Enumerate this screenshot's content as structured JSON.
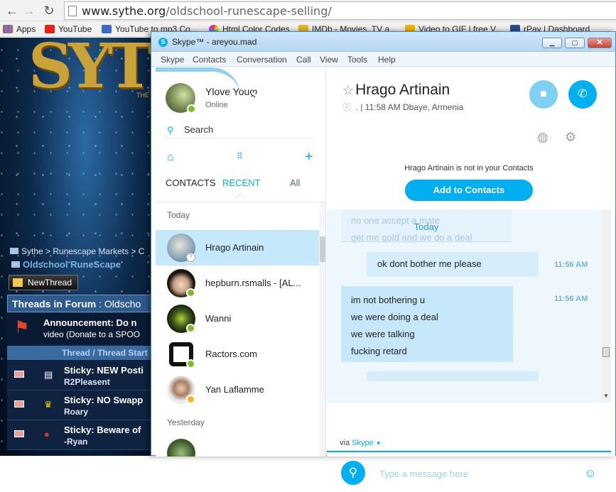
{
  "browser": {
    "url_host": "www.sythe.org",
    "url_path": "/oldschool-runescape-selling/",
    "bookmarks": [
      {
        "label": "Apps",
        "color": "#e0453a"
      },
      {
        "label": "YouTube",
        "color": "#e62117"
      },
      {
        "label": "YouTube to mp3 Co...",
        "color": "#3b6bc4"
      },
      {
        "label": "Html Color Codes",
        "color": "#d54cb8"
      },
      {
        "label": "IMDb - Movies, TV a...",
        "color": "#e3b82a"
      },
      {
        "label": "Video to GIF | free V...",
        "color": "#f5b700"
      },
      {
        "label": "rPay | Dashboard",
        "color": "#2a4b8d"
      }
    ]
  },
  "website": {
    "logo": "SYT",
    "logo_sub": "THE",
    "breadcrumb": "Sythe > Runescape Markets > C",
    "forum": "Oldschool RuneScape",
    "new_thread": "NewThread",
    "threads_header": "Threads in Forum",
    "threads_header_sub": ": Oldscho",
    "announcement_title": "Announcement: Do n",
    "announcement_sub": "video (Donate to a SPOO",
    "col_thread": "Thread",
    "col_starter": "Thread Start",
    "threads": [
      {
        "title": "Sticky: NEW Posti",
        "starter": "R2Pleasent",
        "icon": "doc-icon"
      },
      {
        "title": "Sticky: NO Swapp",
        "starter": "Roary",
        "icon": "crown-icon"
      },
      {
        "title": "Sticky: Beware of",
        "starter": "-Ryan",
        "icon": "warning-icon"
      }
    ]
  },
  "skype": {
    "title": "Skype™ - areyou.mad",
    "menu": [
      "Skype",
      "Contacts",
      "Conversation",
      "Call",
      "View",
      "Tools",
      "Help"
    ],
    "me": {
      "name": "Ylove Youღ",
      "status": "Online"
    },
    "search_label": "Search",
    "tabs": {
      "contacts": "CONTACTS",
      "recent": "RECENT",
      "all": "All"
    },
    "groups": {
      "today": "Today",
      "yesterday": "Yesterday"
    },
    "contacts": [
      {
        "name": "Hrago  Artinain",
        "status": "unknown"
      },
      {
        "name": "hepburn.rsmalls - [AL...",
        "status": "online"
      },
      {
        "name": "Wanni",
        "status": "online"
      },
      {
        "name": "Ractors.com",
        "status": "online"
      },
      {
        "name": "Yan Laflamme",
        "status": "away"
      }
    ],
    "conversation": {
      "name": "Hrago  Artinain",
      "subtitle": ".  |  11:58 AM Dbaye, Armenia",
      "notice": "Hrago  Artinain is not in your Contacts",
      "add_button": "Add to Contacts",
      "ghost_lines": [
        "no one accept a mate",
        "get me gold and we do a deal"
      ],
      "day_marker": "Today",
      "messages": [
        {
          "direction": "out",
          "lines": [
            "ok dont bother me please"
          ],
          "time": "11:56 AM"
        },
        {
          "direction": "in",
          "lines": [
            "im not bothering u",
            "we were doing a deal",
            "we were talking",
            "fucking retard"
          ],
          "time": "11:56 AM"
        }
      ],
      "via": "via",
      "via_link": "Skype",
      "composer_placeholder": "Type a message here"
    }
  }
}
